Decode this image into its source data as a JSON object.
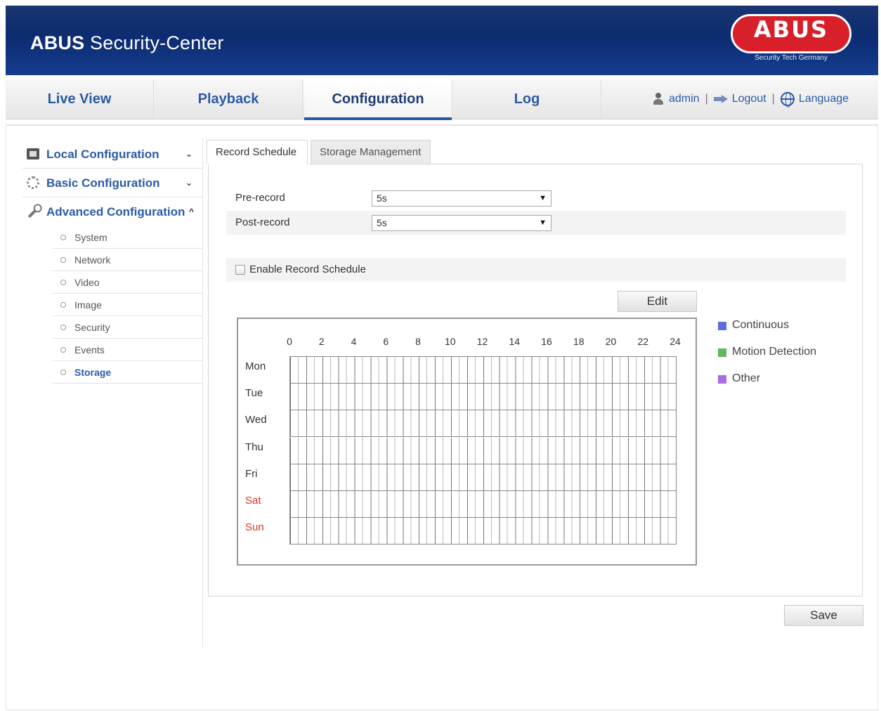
{
  "header": {
    "app_title_brand": "ABUS",
    "app_title_rest": " Security-Center",
    "logo_text": "ABUS",
    "logo_tagline": "Security Tech Germany"
  },
  "nav": {
    "tabs": [
      {
        "label": "Live View"
      },
      {
        "label": "Playback"
      },
      {
        "label": "Configuration"
      },
      {
        "label": "Log"
      }
    ],
    "active_tab": "Configuration",
    "user": "admin",
    "separator": "|",
    "logout": "Logout",
    "language": "Language"
  },
  "sidebar": {
    "sections": [
      {
        "label": "Local Configuration",
        "caret": "⌄"
      },
      {
        "label": "Basic Configuration",
        "caret": "⌄"
      },
      {
        "label": "Advanced Configuration",
        "caret": "^"
      }
    ],
    "sub_items": [
      {
        "label": "System"
      },
      {
        "label": "Network"
      },
      {
        "label": "Video"
      },
      {
        "label": "Image"
      },
      {
        "label": "Security"
      },
      {
        "label": "Events"
      },
      {
        "label": "Storage"
      }
    ],
    "active_sub_item": "Storage"
  },
  "content": {
    "tabs": [
      {
        "label": "Record Schedule"
      },
      {
        "label": "Storage Management"
      }
    ],
    "active_tab": "Record Schedule",
    "pre_record": {
      "label": "Pre-record",
      "value": "5s"
    },
    "post_record": {
      "label": "Post-record",
      "value": "5s"
    },
    "select_arrow": "▼",
    "enable_schedule": {
      "label": "Enable Record Schedule",
      "checked": false
    },
    "edit_button": "Edit",
    "save_button": "Save"
  },
  "schedule": {
    "hour_labels": [
      "0",
      "2",
      "4",
      "6",
      "8",
      "10",
      "12",
      "14",
      "16",
      "18",
      "20",
      "22",
      "24"
    ],
    "days": [
      {
        "label": "Mon",
        "weekend": false
      },
      {
        "label": "Tue",
        "weekend": false
      },
      {
        "label": "Wed",
        "weekend": false
      },
      {
        "label": "Thu",
        "weekend": false
      },
      {
        "label": "Fri",
        "weekend": false
      },
      {
        "label": "Sat",
        "weekend": true
      },
      {
        "label": "Sun",
        "weekend": true
      }
    ],
    "legend": [
      {
        "label": "Continuous",
        "color": "#5b6ee1"
      },
      {
        "label": "Motion Detection",
        "color": "#5cb85c"
      },
      {
        "label": "Other",
        "color": "#a86be0"
      }
    ],
    "weekend_color": "#d9342b"
  }
}
